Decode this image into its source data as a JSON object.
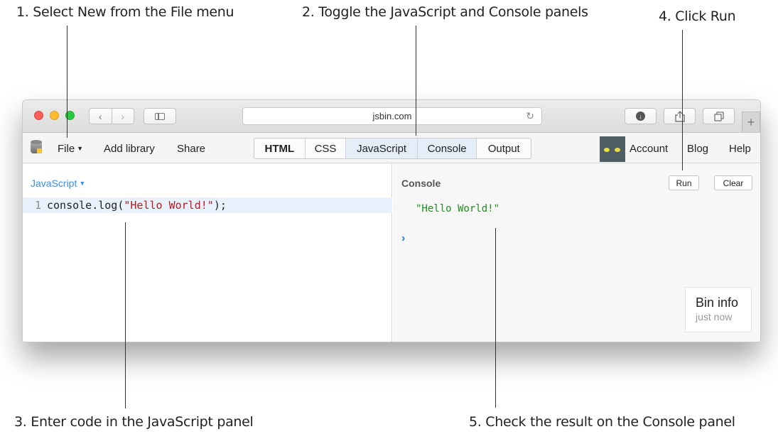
{
  "annotations": {
    "step1": "1. Select New from the File menu",
    "step2": "2. Toggle the JavaScript and Console panels",
    "step3": "3. Enter code in the JavaScript panel",
    "step4": "4. Click Run",
    "step5": "5. Check the result on the Console panel"
  },
  "browser": {
    "url": "jsbin.com",
    "back_icon": "chevron-left",
    "forward_icon": "chevron-right",
    "reload_icon": "reload",
    "new_tab_label": "+"
  },
  "toolbar": {
    "file_label": "File",
    "add_library_label": "Add library",
    "share_label": "Share",
    "panels": [
      {
        "label": "HTML",
        "active": false
      },
      {
        "label": "CSS",
        "active": false
      },
      {
        "label": "JavaScript",
        "active": true
      },
      {
        "label": "Console",
        "active": true
      },
      {
        "label": "Output",
        "active": false
      }
    ],
    "account_label": "Account",
    "blog_label": "Blog",
    "help_label": "Help"
  },
  "js_panel": {
    "label": "JavaScript",
    "line_number": "1",
    "code_prefix": "console.log(",
    "code_string": "\"Hello World!\"",
    "code_suffix": ");"
  },
  "console_panel": {
    "label": "Console",
    "run_label": "Run",
    "clear_label": "Clear",
    "output": "\"Hello World!\"",
    "prompt": "›"
  },
  "bin_info": {
    "title": "Bin info",
    "subtitle": "just now"
  },
  "colors": {
    "accent_blue": "#3a8ee6",
    "string_red": "#c2171d",
    "console_green": "#208d20",
    "active_tab": "#e3eef8"
  }
}
